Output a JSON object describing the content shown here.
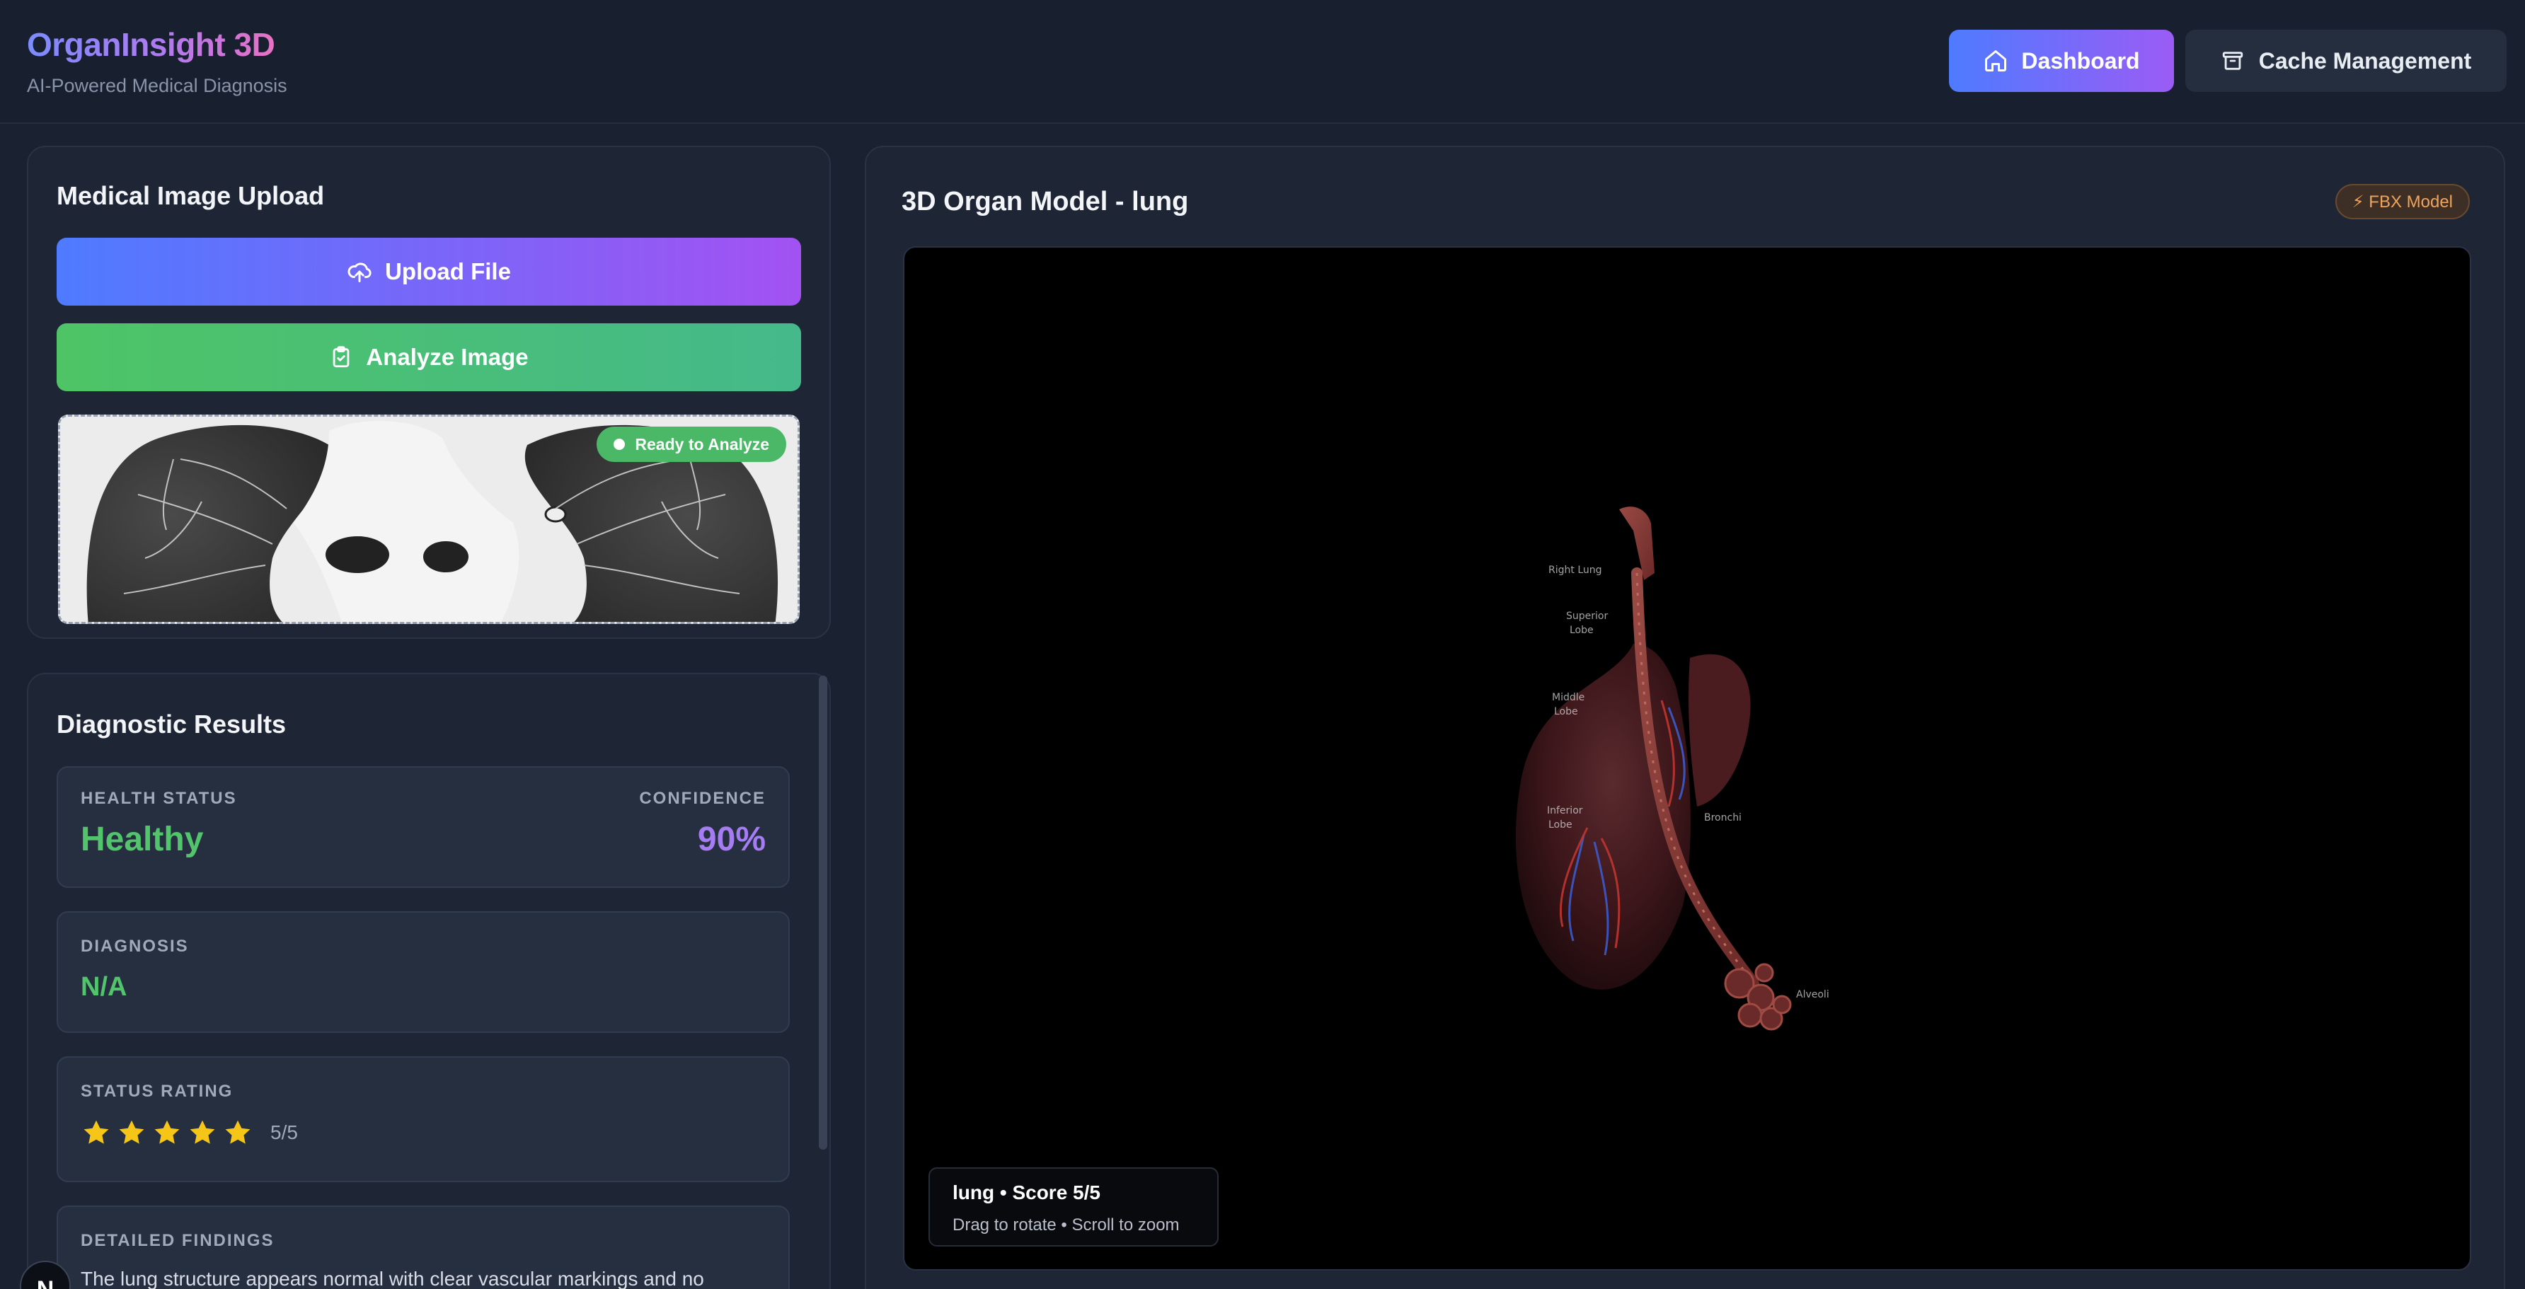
{
  "header": {
    "app_title": "OrganInsight 3D",
    "subtitle": "AI-Powered Medical Diagnosis",
    "nav": {
      "dashboard_label": "Dashboard",
      "cache_label": "Cache Management"
    }
  },
  "upload": {
    "title": "Medical Image Upload",
    "upload_button": "Upload File",
    "analyze_button": "Analyze Image",
    "status_badge": "Ready to Analyze"
  },
  "results": {
    "title": "Diagnostic Results",
    "health_status_label": "HEALTH STATUS",
    "health_status_value": "Healthy",
    "confidence_label": "CONFIDENCE",
    "confidence_value": "90%",
    "diagnosis_label": "DIAGNOSIS",
    "diagnosis_value": "N/A",
    "status_rating_label": "STATUS RATING",
    "rating_stars": 5,
    "rating_max": 5,
    "rating_text": "5/5",
    "detailed_findings_label": "DETAILED FINDINGS",
    "detailed_findings_text": "The lung structure appears normal with clear vascular markings and no"
  },
  "model": {
    "title": "3D Organ Model - lung",
    "badge": "⚡ FBX Model",
    "info_title": "lung • Score 5/5",
    "info_hint": "Drag to rotate • Scroll to zoom"
  },
  "dev_badge": "N",
  "colors": {
    "accent_blue": "#4e7bff",
    "accent_purple": "#a352f2",
    "healthy_green": "#52c56c",
    "confidence_purple": "#a57cf2",
    "star_yellow": "#f5c518",
    "fbx_orange": "#f0a35a"
  },
  "icons": {
    "dashboard": "home-icon",
    "cache": "archive-icon",
    "upload": "cloud-upload-icon",
    "analyze": "clipboard-check-icon",
    "rating": "star-icon"
  }
}
